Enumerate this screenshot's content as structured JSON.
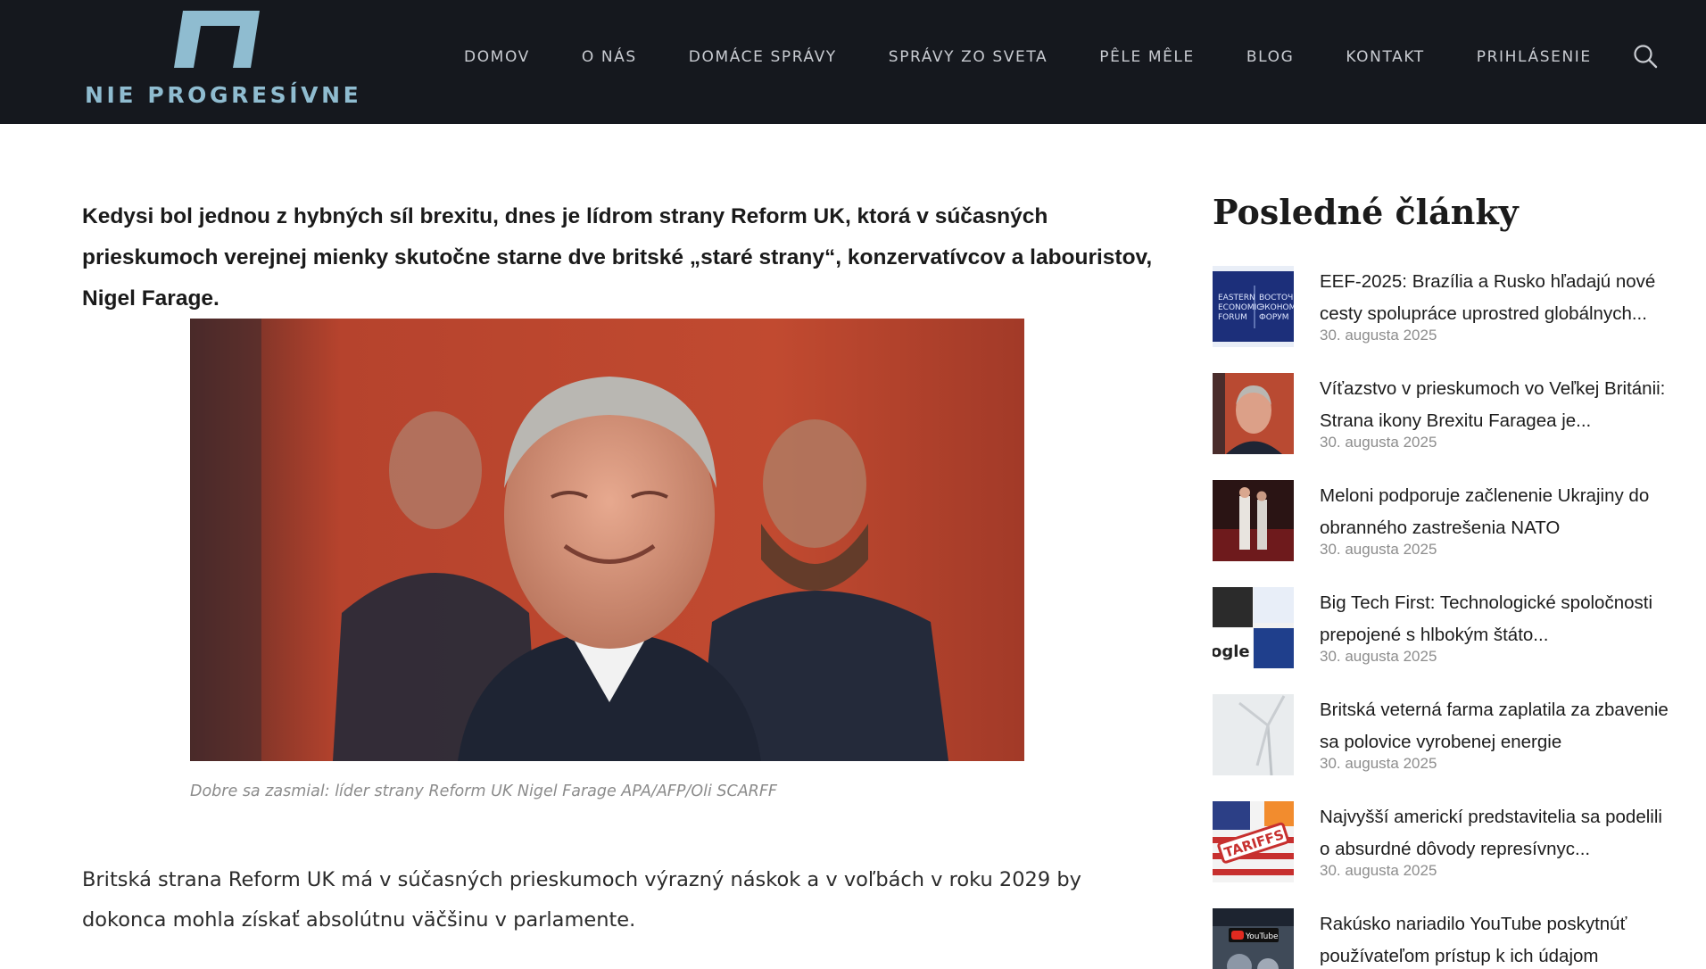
{
  "site": {
    "logo_text": "NIE PROGRESÍVNE",
    "logo_color": "#8fbcd0",
    "header_bg": "#15181e"
  },
  "nav": {
    "items": [
      {
        "label": "DOMOV"
      },
      {
        "label": "O NÁS"
      },
      {
        "label": "DOMÁCE SPRÁVY"
      },
      {
        "label": "SPRÁVY ZO SVETA"
      },
      {
        "label": "PÊLE MÊLE"
      },
      {
        "label": "BLOG"
      },
      {
        "label": "KONTAKT"
      },
      {
        "label": "PRIHLÁSENIE"
      }
    ],
    "search_icon": "search-icon"
  },
  "article": {
    "lead": "Kedysi bol jednou z hybných síl brexitu, dnes je lídrom strany Reform UK, ktorá v súčasných prieskumoch verejnej mienky skutočne starne dve britské „staré strany“, konzervatívcov a labouristov, Nigel Farage.",
    "image_caption": "Dobre sa zasmial: líder strany Reform UK Nigel Farage APA/AFP/Oli SCARFF",
    "body_paragraph": "Britská strana Reform UK má v súčasných prieskumoch výrazný náskok a v voľbách v roku 2029 by dokonca mohla získať absolútnu väčšinu v parlamente."
  },
  "sidebar": {
    "title": "Posledné články",
    "posts": [
      {
        "title": "EEF-2025: Brazília a Rusko hľadajú nové cesty spolupráce uprostred globálnych...",
        "date": "30. augusta 2025",
        "thumb_line1": "EASTERN",
        "thumb_line2": "ECONOMIC",
        "thumb_line3": "FORUM",
        "thumb_line4": "ВОСТОЧ",
        "thumb_line5": "ЭКОНОМ",
        "thumb_line6": "ФОРУМ"
      },
      {
        "title": "Víťazstvo v prieskumoch vo Veľkej Británii: Strana ikony Brexitu Faragea je...",
        "date": "30. augusta 2025"
      },
      {
        "title": "Meloni podporuje začlenenie Ukrajiny do obranného zastrešenia NATO",
        "date": "30. augusta 2025"
      },
      {
        "title": "Big Tech First: Technologické spoločnosti prepojené s hlbokým štáto...",
        "date": "30. augusta 2025",
        "thumb_text": "ogle"
      },
      {
        "title": "Britská veterná farma zaplatila za zbavenie sa polovice vyrobenej energie",
        "date": "30. augusta 2025"
      },
      {
        "title": "Najvyšší americkí predstavitelia sa podelili o absurdné dôvody represívnyc...",
        "date": "30. augusta 2025",
        "thumb_text": "TARIFFS"
      },
      {
        "title": "Rakúsko nariadilo YouTube poskytnúť používateľom prístup k ich údajom",
        "date": "",
        "thumb_text": "YouTube"
      }
    ]
  }
}
